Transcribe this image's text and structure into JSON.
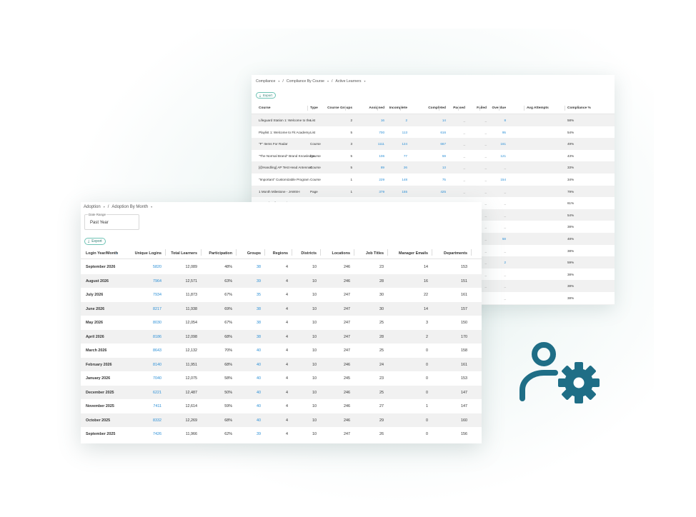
{
  "compliance": {
    "breadcrumb": [
      "Compliance",
      "Compliance By Course",
      "Active Learners"
    ],
    "export_label": "Export",
    "columns": [
      "Course",
      "Type",
      "Course Groups",
      "Assigned",
      "Incomplete",
      "Completed",
      "Passed",
      "Failed",
      "Overdue",
      "Avg Attempts",
      "Compliance %"
    ],
    "rows": [
      [
        "Lifeguard Station 1: Welcome to the",
        "List",
        "2",
        "16",
        "2",
        "14",
        "_",
        "_",
        "8",
        "",
        "58%"
      ],
      [
        "Playlist 1: Welcome to Fit Academy",
        "List",
        "5",
        "700",
        "113",
        "616",
        "_",
        "_",
        "95",
        "",
        "54%"
      ],
      [
        "\"F\" Items For Radar",
        "Course",
        "3",
        "1111",
        "124",
        "667",
        "_",
        "_",
        "161",
        "",
        "49%"
      ],
      [
        "\"The Normal Brand\" Brand Knowledge",
        "Course",
        "5",
        "106",
        "77",
        "59",
        "_",
        "_",
        "121",
        "",
        "43%"
      ],
      [
        "[@Handling] AP Test Head Antennas",
        "Course",
        "5",
        "89",
        "26",
        "13",
        "_",
        "_",
        "_",
        "",
        "33%"
      ],
      [
        "\"Important\" Customizable Program",
        "Course",
        "1",
        "229",
        "148",
        "75",
        "_",
        "_",
        "154",
        "",
        "34%"
      ],
      [
        "1 Month Milestone - JAWSH",
        "Page",
        "1",
        "379",
        "155",
        "425",
        "_",
        "_",
        "_",
        "",
        "79%"
      ],
      [
        "1 Month Milestone in Home",
        "Page",
        "1",
        "351",
        "28",
        "144",
        "_",
        "_",
        "_",
        "",
        "61%"
      ],
      [
        "",
        "",
        "",
        "",
        "",
        "",
        "",
        "_",
        "_",
        "",
        "54%"
      ],
      [
        "",
        "",
        "",
        "",
        "",
        "",
        "",
        "_",
        "_",
        "",
        "38%"
      ],
      [
        "",
        "",
        "",
        "",
        "",
        "",
        "",
        "_",
        "58",
        "",
        "48%"
      ],
      [
        "",
        "",
        "",
        "",
        "",
        "",
        "",
        "_",
        "_",
        "",
        "38%"
      ],
      [
        "",
        "",
        "",
        "",
        "",
        "",
        "",
        "_",
        "2",
        "",
        "59%"
      ],
      [
        "",
        "",
        "",
        "",
        "",
        "",
        "",
        "_",
        "_",
        "",
        "38%"
      ],
      [
        "",
        "",
        "",
        "",
        "",
        "",
        "",
        "_",
        "_",
        "",
        "38%"
      ],
      [
        "",
        "",
        "",
        "",
        "",
        "",
        "",
        "",
        "_",
        "",
        "38%"
      ],
      [
        "",
        "",
        "",
        "",
        "",
        "",
        "",
        "",
        "",
        "",
        "38%"
      ]
    ]
  },
  "adoption": {
    "breadcrumb": [
      "Adoption",
      "Adoption By Month"
    ],
    "date_range_label": "Date Range",
    "date_range_value": "Past Year",
    "export_label": "Export",
    "columns": [
      "Login Year/Month",
      "Unique Logins",
      "Total Learners",
      "Participation",
      "Groups",
      "Regions",
      "Districts",
      "Locations",
      "Job Titles",
      "Manager Emails",
      "Departments"
    ],
    "rows": [
      [
        "September 2026",
        "5820",
        "12,089",
        "48%",
        "38",
        "4",
        "10",
        "246",
        "23",
        "14",
        "153"
      ],
      [
        "August 2026",
        "7964",
        "12,571",
        "63%",
        "39",
        "4",
        "10",
        "246",
        "28",
        "16",
        "151"
      ],
      [
        "July 2026",
        "7934",
        "11,873",
        "67%",
        "35",
        "4",
        "10",
        "247",
        "30",
        "22",
        "161"
      ],
      [
        "June 2026",
        "8217",
        "11,938",
        "69%",
        "38",
        "4",
        "10",
        "247",
        "30",
        "14",
        "157"
      ],
      [
        "May 2026",
        "8030",
        "12,054",
        "67%",
        "38",
        "4",
        "10",
        "247",
        "25",
        "3",
        "150"
      ],
      [
        "April 2026",
        "8186",
        "12,098",
        "68%",
        "38",
        "4",
        "10",
        "247",
        "28",
        "2",
        "170"
      ],
      [
        "March 2026",
        "8643",
        "12,132",
        "70%",
        "40",
        "4",
        "10",
        "247",
        "25",
        "0",
        "158"
      ],
      [
        "February 2026",
        "8140",
        "11,951",
        "68%",
        "40",
        "4",
        "10",
        "246",
        "24",
        "0",
        "161"
      ],
      [
        "January 2026",
        "7040",
        "12,075",
        "58%",
        "40",
        "4",
        "10",
        "245",
        "23",
        "0",
        "153"
      ],
      [
        "December 2025",
        "6221",
        "12,487",
        "50%",
        "40",
        "4",
        "10",
        "246",
        "25",
        "0",
        "147"
      ],
      [
        "November 2025",
        "7411",
        "12,614",
        "59%",
        "40",
        "4",
        "10",
        "246",
        "27",
        "1",
        "147"
      ],
      [
        "October 2025",
        "8332",
        "12,269",
        "68%",
        "40",
        "4",
        "10",
        "246",
        "29",
        "0",
        "160"
      ],
      [
        "September 2025",
        "7426",
        "11,966",
        "62%",
        "39",
        "4",
        "10",
        "247",
        "26",
        "0",
        "156"
      ]
    ]
  },
  "icon": {
    "name": "user-gear-icon",
    "color": "#1f6e86"
  },
  "colors": {
    "link": "#2b8fd6",
    "accent": "#6ec3b5"
  }
}
